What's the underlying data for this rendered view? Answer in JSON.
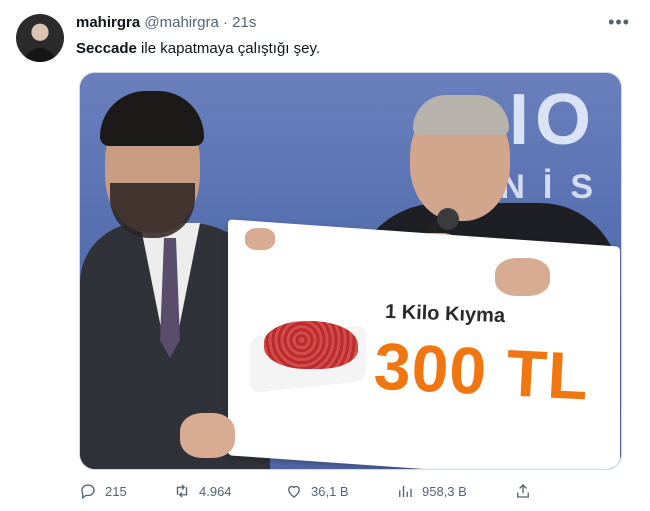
{
  "tweet": {
    "display_name": "mahirgra",
    "handle": "@mahirgra",
    "separator": "·",
    "time": "21s",
    "text_bold": "Seccade",
    "text_rest": " ile kapatmaya çalıştığı şey."
  },
  "media": {
    "sign_label": "1 Kilo Kıyma",
    "sign_price": "300 TL",
    "background_letters": "IO",
    "background_letters_2": "NİS"
  },
  "actions": {
    "reply_count": "215",
    "retweet_count": "4.964",
    "like_count": "36,1 B",
    "view_count": "958,3 B"
  },
  "icons": [
    "more-icon",
    "reply-icon",
    "retweet-icon",
    "like-icon",
    "views-icon",
    "share-icon"
  ],
  "colors": {
    "price_orange": "#f2760f",
    "meta_gray": "#536471"
  }
}
